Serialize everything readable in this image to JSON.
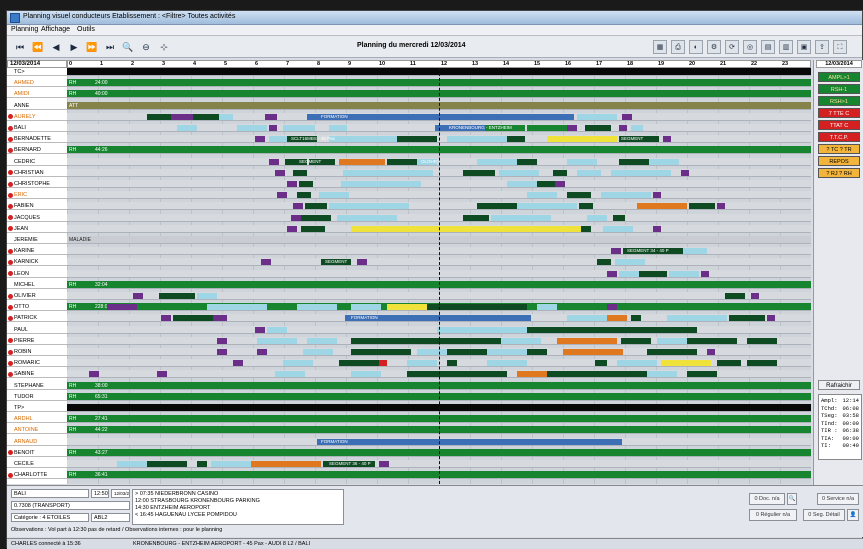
{
  "window": {
    "title": "Planning visuel conducteurs Etablissement : <Filtre> Toutes activités"
  },
  "menu": [
    "Planning",
    "Affichage",
    "Outils"
  ],
  "toolbar": {
    "nav_buttons": [
      "first-icon",
      "prev-page-icon",
      "prev-icon",
      "next-icon",
      "next-page-icon",
      "last-icon",
      "zoom-in-icon",
      "zoom-out-icon",
      "center-icon"
    ],
    "planning_title": "Planning du mercredi 12/03/2014",
    "right_buttons": [
      "calendar-icon",
      "print-icon",
      "filter-icon",
      "settings-icon",
      "refresh-icon",
      "target-icon",
      "grid-icon",
      "layout-icon",
      "view-icon",
      "export-icon",
      "expand-icon"
    ]
  },
  "header": {
    "date_left": "12/03/2014",
    "date_right": "12/03/2014",
    "hours": [
      "0",
      "1",
      "2",
      "3",
      "4",
      "5",
      "6",
      "7",
      "8",
      "9",
      "10",
      "11",
      "12",
      "13",
      "14",
      "15",
      "16",
      "17",
      "18",
      "19",
      "20",
      "21",
      "22",
      "23"
    ]
  },
  "rows": [
    {
      "name": "TC>",
      "dot": false,
      "lane": "black",
      "label": "",
      "label2": ""
    },
    {
      "name": "AHMED",
      "dot": false,
      "orange": true,
      "lane": "green",
      "label": "RH",
      "label2": "24:00"
    },
    {
      "name": "AMIDI",
      "dot": false,
      "orange": true,
      "lane": "green",
      "label": "RH",
      "label2": "40:00"
    },
    {
      "name": "ANNE",
      "dot": false,
      "lane": "olive",
      "label": "ATT",
      "label2": ""
    },
    {
      "name": "AURELY",
      "dot": true,
      "orange": true,
      "lane": "light",
      "label": "",
      "label2": ""
    },
    {
      "name": "BALI",
      "dot": true,
      "lane": "light",
      "label": "",
      "label2": ""
    },
    {
      "name": "BERNADETTE",
      "dot": true,
      "lane": "light",
      "label": "",
      "label2": ""
    },
    {
      "name": "BERNARD",
      "dot": true,
      "lane": "green",
      "label": "RH",
      "label2": "44:26"
    },
    {
      "name": "CEDRIC",
      "dot": false,
      "lane": "light",
      "label": "",
      "label2": ""
    },
    {
      "name": "CHRISTIAN",
      "dot": true,
      "lane": "light",
      "label": "",
      "label2": ""
    },
    {
      "name": "CHRISTOPHE",
      "dot": true,
      "lane": "light",
      "label": "",
      "label2": ""
    },
    {
      "name": "ERIC",
      "dot": true,
      "orange": true,
      "lane": "light",
      "label": "",
      "label2": ""
    },
    {
      "name": "FABIEN",
      "dot": true,
      "lane": "light",
      "label": "",
      "label2": ""
    },
    {
      "name": "JACQUES",
      "dot": true,
      "lane": "light",
      "label": "",
      "label2": ""
    },
    {
      "name": "JEAN",
      "dot": true,
      "lane": "light",
      "label": "",
      "label2": ""
    },
    {
      "name": "JEREMIE",
      "dot": false,
      "lane": "grey",
      "label": "MALADIE",
      "label2": ""
    },
    {
      "name": "KARINE",
      "dot": true,
      "lane": "light",
      "label": "",
      "label2": ""
    },
    {
      "name": "KARNICK",
      "dot": true,
      "lane": "light",
      "label": "",
      "label2": ""
    },
    {
      "name": "LEON",
      "dot": true,
      "lane": "light",
      "label": "",
      "label2": ""
    },
    {
      "name": "MICHEL",
      "dot": false,
      "lane": "green",
      "label": "RH",
      "label2": "32:04"
    },
    {
      "name": "OLIVIER",
      "dot": true,
      "lane": "light",
      "label": "",
      "label2": ""
    },
    {
      "name": "OTTO",
      "dot": true,
      "lane": "green",
      "label": "RH",
      "label2": "228:02"
    },
    {
      "name": "PATRICK",
      "dot": true,
      "lane": "light",
      "label": "",
      "label2": ""
    },
    {
      "name": "PAUL",
      "dot": false,
      "lane": "light",
      "label": "",
      "label2": ""
    },
    {
      "name": "PIERRE",
      "dot": true,
      "lane": "light",
      "label": "",
      "label2": ""
    },
    {
      "name": "ROBIN",
      "dot": true,
      "lane": "light",
      "label": "",
      "label2": ""
    },
    {
      "name": "ROMARIC",
      "dot": true,
      "lane": "light",
      "label": "",
      "label2": ""
    },
    {
      "name": "SABINE",
      "dot": true,
      "lane": "light",
      "label": "",
      "label2": ""
    },
    {
      "name": "STEPHANE",
      "dot": false,
      "lane": "green",
      "label": "RH",
      "label2": "38:00"
    },
    {
      "name": "TUDOR",
      "dot": false,
      "lane": "green",
      "label": "RH",
      "label2": "65:31"
    },
    {
      "name": "TP>",
      "dot": false,
      "lane": "black",
      "label": "",
      "label2": ""
    },
    {
      "name": "ARDHL",
      "dot": false,
      "orange": true,
      "lane": "green",
      "label": "RH",
      "label2": "27:41"
    },
    {
      "name": "ANTOINE",
      "dot": false,
      "orange": true,
      "lane": "green",
      "label": "RH",
      "label2": "44:22"
    },
    {
      "name": "ARNAUD",
      "dot": false,
      "orange": true,
      "lane": "light",
      "label": "",
      "label2": ""
    },
    {
      "name": "BENOIT",
      "dot": true,
      "lane": "green",
      "label": "RH",
      "label2": "43:27"
    },
    {
      "name": "CECILE",
      "dot": false,
      "lane": "light",
      "label": "",
      "label2": ""
    },
    {
      "name": "CHARLOTTE",
      "dot": true,
      "lane": "green",
      "label": "RH",
      "label2": "36:41"
    }
  ],
  "bar_texts": {
    "formation": "FORMATION",
    "kronenbourg": "KRONENBOURG - ENTZHEIM",
    "segment": "SEGMENT",
    "olohr": "OLOHR",
    "sceaux": "SCLT16MBS - 45 Pax",
    "segment34": "SEGMENT 34 - 40 P",
    "segment36": "SEGMENT 36 - 40 P"
  },
  "right_panel": {
    "boxes": [
      {
        "label": "AMPL>1",
        "kind": "g"
      },
      {
        "label": "RSH-1",
        "kind": "g"
      },
      {
        "label": "RSH>1",
        "kind": "g"
      },
      {
        "label": "7 TTE C",
        "kind": "r"
      },
      {
        "label": "TTAT C",
        "kind": "r"
      },
      {
        "label": "T.T.C.P.",
        "kind": "r"
      },
      {
        "label": "? TC ? TR",
        "kind": "o"
      },
      {
        "label": "REPOS",
        "kind": "o"
      },
      {
        "label": "? RJ ? RH",
        "kind": "o"
      }
    ],
    "refresh_label": "Rafraichir",
    "stats": [
      {
        "k": "Ampl:",
        "v": "12:14"
      },
      {
        "k": "TChd:",
        "v": "06:08"
      },
      {
        "k": "TSeg:",
        "v": "03:58"
      },
      {
        "k": "TInd:",
        "v": "00:00"
      },
      {
        "k": "TIR :",
        "v": "06:38"
      },
      {
        "k": "TIA:",
        "v": "00:09"
      },
      {
        "k": "TI:",
        "v": "00:49"
      }
    ]
  },
  "details": {
    "driver": "BALI",
    "time": "12:50",
    "date": "12/03/2014",
    "vehicle": "0.7308 (TRANSPORT)",
    "category": "Catégorie : 4 ETOILES",
    "code": "ABL2",
    "trips": [
      "> 07:35 NIEDERBRONN CASINO",
      "12:00 STRASBOURG KRONENBOURG PARKING",
      "14:30 ENTZHEIM AEROPORT",
      "< 16:45 HAGUENAU LYCEE POMPIDOU"
    ],
    "observations": "Observations : Vol part à 12:30 pas de retard  / Observations internes : pour le planning",
    "btn_doc": "0 Doc. n/a",
    "btn_service": "0 Service n/a",
    "btn_regular": "0 Régulier n/a",
    "btn_segdetail": "0 Seg. Détail"
  },
  "status": {
    "user": "CHARLES connecté à 15:36",
    "route": "KRONENBOURG - ENTZHEIM AEROPORT - 45 Pax - AUDI 8 L2 / BALI"
  },
  "colors": {
    "green": "#17852f",
    "blue": "#3c6fb6",
    "lightblue": "#9fd6e6",
    "purple": "#6b2f8a",
    "orange": "#e07820",
    "yellow": "#efe23a",
    "darkgreen": "#0e4a22",
    "red": "#d42020"
  }
}
